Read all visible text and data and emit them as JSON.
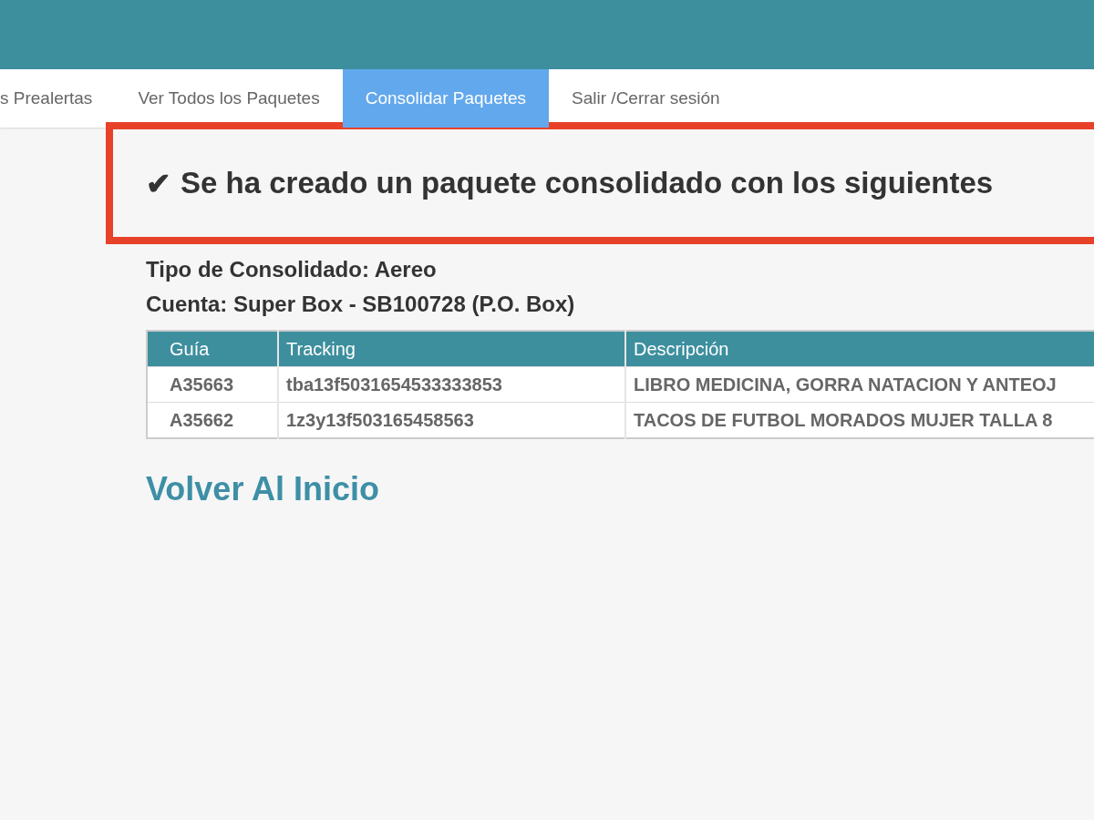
{
  "nav": {
    "items": [
      {
        "label": "s Prealertas",
        "selected": false
      },
      {
        "label": "Ver Todos los Paquetes",
        "selected": false
      },
      {
        "label": "Consolidar Paquetes",
        "selected": true
      },
      {
        "label": "Salir /Cerrar sesión",
        "selected": false
      }
    ]
  },
  "alert": {
    "icon": "✔",
    "message": "Se ha creado un paquete consolidado con los siguientes"
  },
  "details": [
    "Tipo de Consolidado: Aereo",
    "Cuenta: Super Box - SB100728 (P.O. Box)"
  ],
  "table": {
    "columns": [
      "Guía",
      "Tracking",
      "Descripción"
    ],
    "rows": [
      [
        "A35663",
        "tba13f5031654533333853",
        "LIBRO MEDICINA, GORRA NATACION Y ANTEOJ"
      ],
      [
        "A35662",
        "1z3y13f503165458563",
        "TACOS DE FUTBOL MORADOS MUJER TALLA 8"
      ]
    ]
  },
  "back_link": "Volver Al Inicio"
}
